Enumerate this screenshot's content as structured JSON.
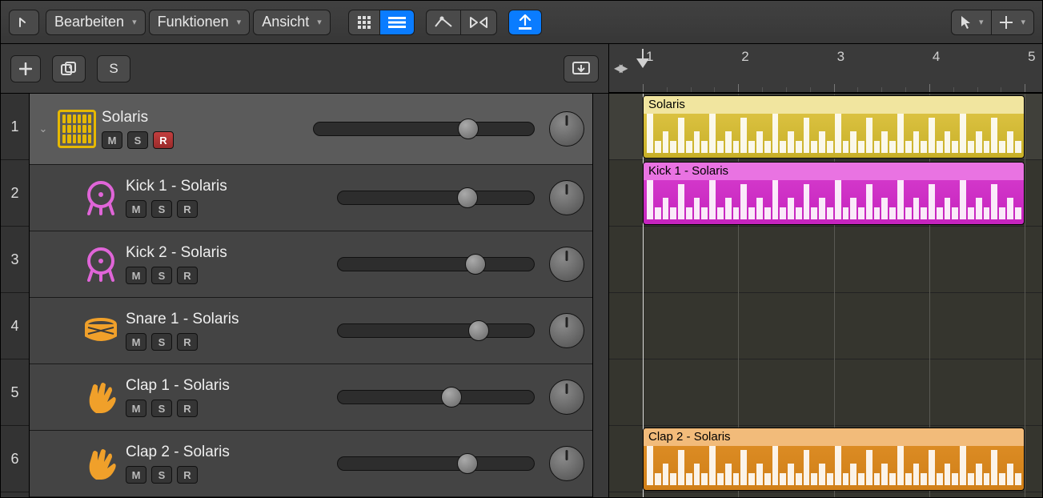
{
  "toolbar": {
    "menus": [
      {
        "id": "edit",
        "label": "Bearbeiten"
      },
      {
        "id": "functions",
        "label": "Funktionen"
      },
      {
        "id": "view",
        "label": "Ansicht"
      }
    ],
    "solo_label": "S"
  },
  "ruler": {
    "marks": [
      1,
      2,
      3,
      4,
      5
    ]
  },
  "tracks": [
    {
      "num": 1,
      "name": "Solaris",
      "main": true,
      "icon": "drum-machine",
      "color": "#e6b800",
      "rec": true,
      "slider": 0.7
    },
    {
      "num": 2,
      "name": "Kick 1 - Solaris",
      "main": false,
      "icon": "kick",
      "color": "#e065d8",
      "rec": false,
      "slider": 0.66
    },
    {
      "num": 3,
      "name": "Kick 2 - Solaris",
      "main": false,
      "icon": "kick",
      "color": "#e065d8",
      "rec": false,
      "slider": 0.7
    },
    {
      "num": 4,
      "name": "Snare 1 - Solaris",
      "main": false,
      "icon": "snare",
      "color": "#f0a02a",
      "rec": false,
      "slider": 0.72
    },
    {
      "num": 5,
      "name": "Clap 1 - Solaris",
      "main": false,
      "icon": "clap",
      "color": "#f0a02a",
      "rec": false,
      "slider": 0.58
    },
    {
      "num": 6,
      "name": "Clap 2 - Solaris",
      "main": false,
      "icon": "clap",
      "color": "#f0a02a",
      "rec": false,
      "slider": 0.66
    }
  ],
  "msr_labels": {
    "mute": "M",
    "solo": "S",
    "record": "R"
  },
  "regions": [
    {
      "track": 0,
      "name": "Solaris",
      "color": "yellow",
      "start": 1,
      "end": 5
    },
    {
      "track": 1,
      "name": "Kick 1 - Solaris",
      "color": "magenta",
      "start": 1,
      "end": 5
    },
    {
      "track": 5,
      "name": "Clap 2 - Solaris",
      "color": "orange",
      "start": 1,
      "end": 5
    }
  ],
  "playhead_bar": 1,
  "arrange_bars_visible": 4.2
}
